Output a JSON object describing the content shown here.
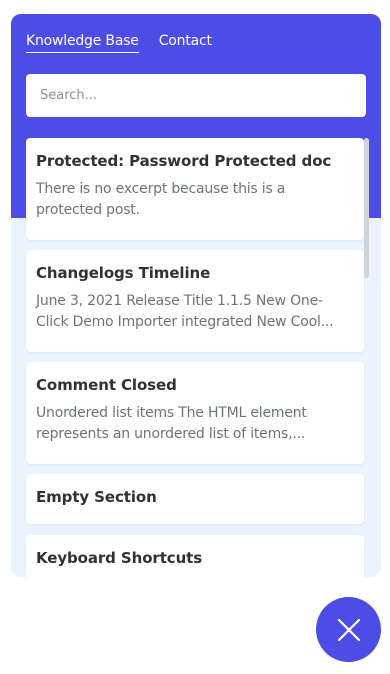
{
  "colors": {
    "accent": "#4c4ce6",
    "panel_background": "#ebf3fe",
    "card_background": "#ffffff"
  },
  "tabs": [
    {
      "label": "Knowledge Base",
      "active": true
    },
    {
      "label": "Contact",
      "active": false
    }
  ],
  "search": {
    "placeholder": "Search...",
    "value": ""
  },
  "articles": [
    {
      "title": "Protected: Password Protected doc",
      "excerpt": "There is no excerpt because this is a protected post."
    },
    {
      "title": "Changelogs Timeline",
      "excerpt": "June 3, 2021 Release Title 1.1.5 New One-Click Demo Importer integrated New Cool..."
    },
    {
      "title": "Comment Closed",
      "excerpt": "Unordered list items The HTML  element represents an unordered list of items,..."
    },
    {
      "title": "Empty Section",
      "excerpt": ""
    },
    {
      "title": "Keyboard Shortcuts",
      "excerpt": ""
    }
  ],
  "close_button": {
    "icon": "close-icon"
  }
}
